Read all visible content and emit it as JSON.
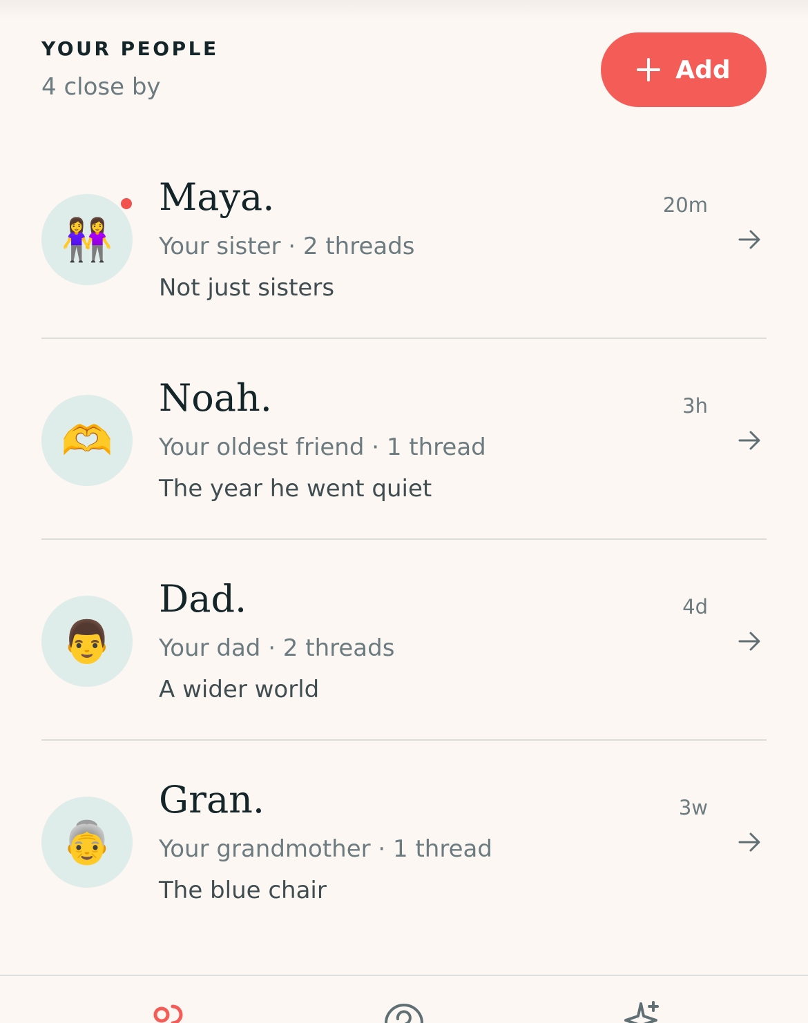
{
  "header": {
    "eyebrow": "YOUR PEOPLE",
    "subtitle": "4 close by",
    "add_label": "Add"
  },
  "colors": {
    "accent": "#f45c57",
    "avatar_bg": "#deecea",
    "background": "#fcf7f2",
    "unread": "#f1524d"
  },
  "people": [
    {
      "name": "Maya.",
      "meta": "Your sister · 2 threads",
      "thread": "Not just sisters",
      "time": "20m",
      "avatar": "👭",
      "unread": true
    },
    {
      "name": "Noah.",
      "meta": "Your oldest friend · 1 thread",
      "thread": "The year he went quiet",
      "time": "3h",
      "avatar": "🫶",
      "unread": false
    },
    {
      "name": "Dad.",
      "meta": "Your dad · 2 threads",
      "thread": "A wider world",
      "time": "4d",
      "avatar": "👨",
      "unread": false
    },
    {
      "name": "Gran.",
      "meta": "Your grandmother · 1 thread",
      "thread": "The blue chair",
      "time": "3w",
      "avatar": "👵",
      "unread": false
    }
  ],
  "bottom_nav": {
    "items": [
      {
        "icon": "people-icon",
        "active": true
      },
      {
        "icon": "question-icon",
        "active": false
      },
      {
        "icon": "sparkle-icon",
        "active": false
      }
    ]
  }
}
